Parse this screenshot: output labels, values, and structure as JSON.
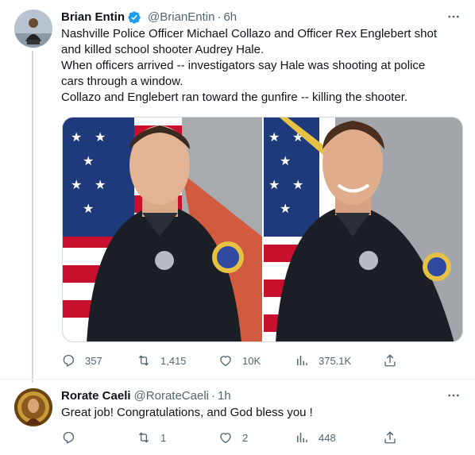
{
  "tweets": [
    {
      "display_name": "Brian Entin",
      "verified": true,
      "handle": "@BrianEntin",
      "separator": "·",
      "time": "6h",
      "text_lines": [
        "Nashville Police Officer Michael Collazo and Officer Rex Englebert shot",
        "and killed school shooter Audrey Hale.",
        "When officers arrived -- investigators say Hale was shooting at police",
        "cars through a window.",
        "Collazo and Englebert ran toward the gunfire -- killing the shooter."
      ],
      "media": [
        {
          "subject": "officer portrait in front of flag",
          "icon": "photo-left"
        },
        {
          "subject": "officer portrait in front of flag",
          "icon": "photo-right"
        }
      ],
      "actions": {
        "replies": "357",
        "retweets": "1,415",
        "likes": "10K",
        "views": "375.1K"
      }
    },
    {
      "display_name": "Rorate Caeli",
      "verified": false,
      "handle": "@RorateCaeli",
      "separator": "·",
      "time": "1h",
      "text_lines": [
        "Great job! Congratulations, and God bless you !"
      ],
      "actions": {
        "replies": "",
        "retweets": "1",
        "likes": "2",
        "views": "448"
      }
    }
  ],
  "colors": {
    "text": "#0f1419",
    "secondary": "#536471",
    "verified_blue": "#1d9bf0",
    "border": "#eff3f4"
  },
  "icons": [
    "reply-icon",
    "retweet-icon",
    "like-icon",
    "views-icon",
    "share-icon",
    "more-icon",
    "verified-badge-icon"
  ]
}
